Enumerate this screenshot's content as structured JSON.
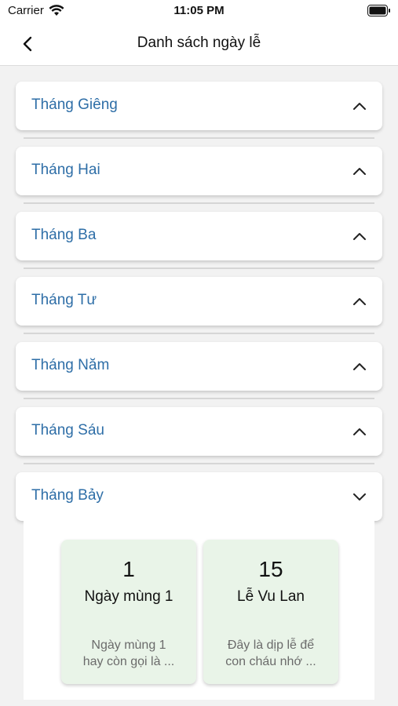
{
  "status_bar": {
    "carrier": "Carrier",
    "time": "11:05 PM"
  },
  "nav": {
    "title": "Danh sách ngày lễ"
  },
  "months": [
    {
      "label": "Tháng Giêng",
      "expanded": false
    },
    {
      "label": "Tháng Hai",
      "expanded": false
    },
    {
      "label": "Tháng Ba",
      "expanded": false
    },
    {
      "label": "Tháng Tư",
      "expanded": false
    },
    {
      "label": "Tháng Năm",
      "expanded": false
    },
    {
      "label": "Tháng Sáu",
      "expanded": false
    },
    {
      "label": "Tháng Bảy",
      "expanded": true
    }
  ],
  "holidays": [
    {
      "day": "1",
      "name": "Ngày mùng 1",
      "desc": "Ngày mùng 1\nhay còn gọi là ..."
    },
    {
      "day": "15",
      "name": "Lễ Vu Lan",
      "desc": "Đây là dịp lễ để\ncon cháu nhớ ..."
    }
  ],
  "colors": {
    "month_label": "#2e6ea7",
    "holiday_card_bg": "#e9f4e8",
    "page_bg": "#f2f2f2"
  }
}
